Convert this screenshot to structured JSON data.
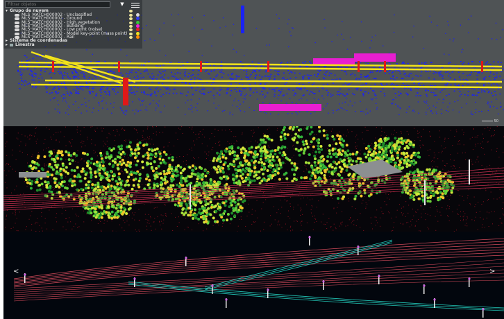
{
  "search": {
    "placeholder": "Filtrar objetos"
  },
  "toolbar": {
    "filter_icon": "filter-icon",
    "menu_icon": "hamburger-menu-icon"
  },
  "tree": {
    "group_label": "Grupo de nuvem",
    "layers": [
      {
        "label": "MLS_MATCH000002 - Unclassified",
        "color": "#d8d8d8"
      },
      {
        "label": "MLS_MATCH000002 - Ground",
        "color": "#2d3bf0"
      },
      {
        "label": "MLS_MATCH000002 - High vegetation",
        "color": "#37c737"
      },
      {
        "label": "MLS_MATCH000002 - Building",
        "color": "#f020d8"
      },
      {
        "label": "MLS_MATCH000002 - Low point (noise)",
        "color": "#e82020"
      },
      {
        "label": "MLS_MATCH000002 - Model key-point (mass point)",
        "color": "#f0e020"
      },
      {
        "label": "MLS_MATCH000002 - Rail",
        "color": "#ff8a00"
      }
    ],
    "coord_label": "Sistema de coordenadas",
    "lines_label": "Linestra"
  },
  "scale": {
    "label": "50"
  },
  "nav": {
    "left": "<",
    "right": ">"
  },
  "colors": {
    "ground": "#1a22f5",
    "rail": "#f2e31a",
    "building": "#e81ed0",
    "pole": "#e01818",
    "powerline_red": "#d24a5a",
    "powerline_teal": "#22c7b8"
  }
}
